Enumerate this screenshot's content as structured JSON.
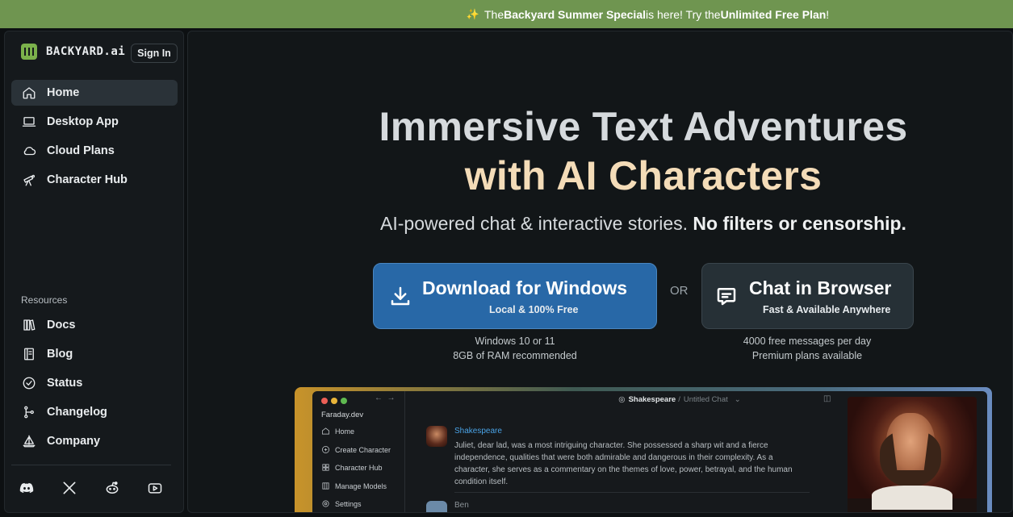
{
  "banner": {
    "icon": "sparkle-icon",
    "prefix": "The ",
    "bold1": "Backyard Summer Special",
    "middle": " is here! Try the ",
    "bold2": "Unlimited Free Plan",
    "suffix": "!"
  },
  "sidebar": {
    "logo_text": "BACKYARD.ai",
    "sign_in": "Sign In",
    "nav": [
      {
        "label": "Home",
        "icon": "home-icon"
      },
      {
        "label": "Desktop App",
        "icon": "laptop-icon"
      },
      {
        "label": "Cloud Plans",
        "icon": "cloud-icon"
      },
      {
        "label": "Character Hub",
        "icon": "telescope-icon"
      }
    ],
    "resources_label": "Resources",
    "resources": [
      {
        "label": "Docs",
        "icon": "books-icon"
      },
      {
        "label": "Blog",
        "icon": "notebook-icon"
      },
      {
        "label": "Status",
        "icon": "check-circle-icon"
      },
      {
        "label": "Changelog",
        "icon": "git-branch-icon"
      },
      {
        "label": "Company",
        "icon": "sailboat-icon"
      }
    ],
    "social": [
      "discord-icon",
      "x-icon",
      "reddit-icon",
      "youtube-icon"
    ]
  },
  "hero": {
    "title_line1": "Immersive Text Adventures",
    "title_line2": "with AI Characters",
    "subtitle_plain": "AI-powered chat & interactive stories. ",
    "subtitle_bold": "No filters or censorship.",
    "download": {
      "title": "Download for Windows",
      "sub": "Local & 100% Free",
      "note1": "Windows 10 or 11",
      "note2": "8GB of RAM recommended"
    },
    "or": "OR",
    "browser": {
      "title": "Chat in Browser",
      "sub": "Fast & Available Anywhere",
      "note1": "4000 free messages per day",
      "note2": "Premium plans available"
    }
  },
  "preview": {
    "app_title": "Faraday.dev",
    "menu": [
      "Home",
      "Create Character",
      "Character Hub",
      "Manage Models",
      "Settings"
    ],
    "chat_character": "Shakespeare",
    "chat_title": "Untitled Chat",
    "message_author": "Shakespeare",
    "message_text": "Juliet, dear lad, was a most intriguing character. She possessed a sharp wit and a fierce independence, qualities that were both admirable and dangerous in their complexity. As a character, she serves as a commentary on the themes of love, power, betrayal, and the human condition itself.",
    "next_author": "Ben"
  },
  "colors": {
    "banner_bg": "#6f9550",
    "download_btn": "#2868a7",
    "title_accent": "#f4dcb8",
    "logo_green": "#7bb14b"
  }
}
